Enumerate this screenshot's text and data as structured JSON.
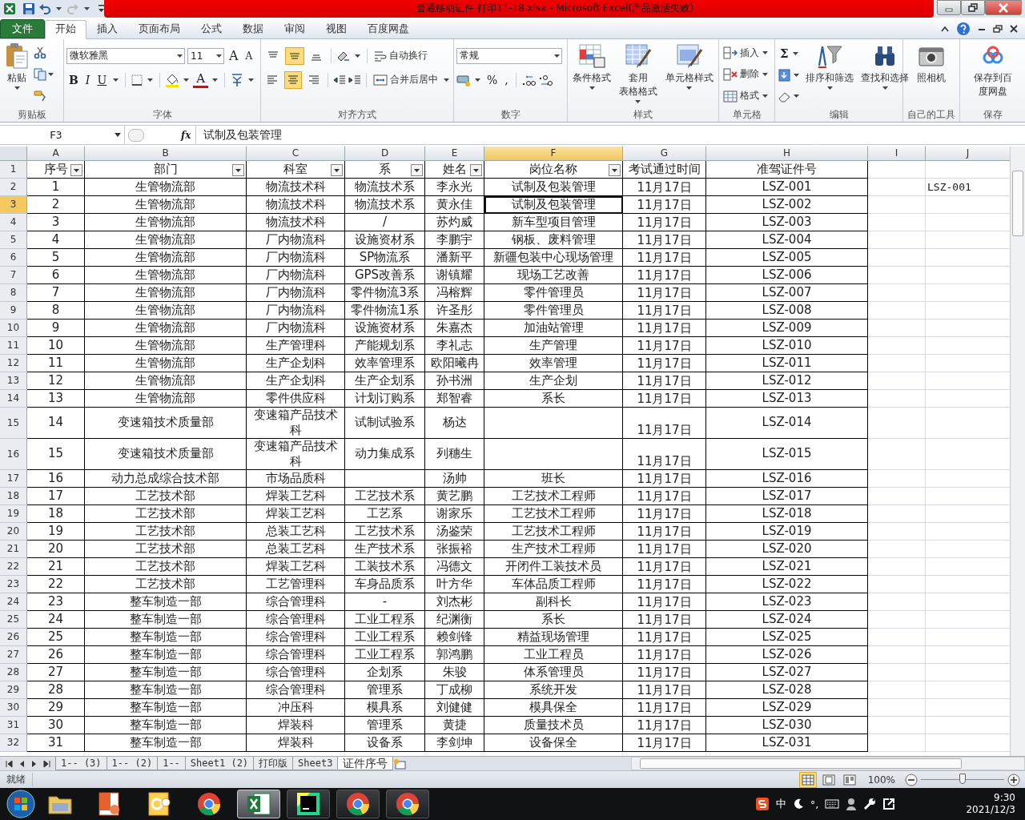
{
  "window": {
    "title": "普通移动证件 打印11-18.xlsx  -  Microsoft Excel(产品激活失败)"
  },
  "tabs": [
    {
      "label": "文件",
      "kind": "file",
      "selected": false
    },
    {
      "label": "开始",
      "kind": "tab",
      "selected": true
    },
    {
      "label": "插入",
      "kind": "tab",
      "selected": false
    },
    {
      "label": "页面布局",
      "kind": "tab",
      "selected": false
    },
    {
      "label": "公式",
      "kind": "tab",
      "selected": false
    },
    {
      "label": "数据",
      "kind": "tab",
      "selected": false
    },
    {
      "label": "审阅",
      "kind": "tab",
      "selected": false
    },
    {
      "label": "视图",
      "kind": "tab",
      "selected": false
    },
    {
      "label": "百度网盘",
      "kind": "tab",
      "selected": false
    }
  ],
  "ribbon": [
    {
      "kind": "clipboard",
      "label": "剪贴板",
      "paste": "粘贴"
    },
    {
      "kind": "font",
      "label": "字体",
      "font": "微软雅黑",
      "size": "11",
      "grow": "A",
      "shrink": "A",
      "bold": "B",
      "italic": "I",
      "underline": "U",
      "font_color_label": "A"
    },
    {
      "kind": "alignment",
      "label": "对齐方式",
      "wrap": "自动换行",
      "merge": "合并后居中",
      "vertical": [
        {
          "kind": "top",
          "selected": false
        },
        {
          "kind": "middle",
          "selected": true
        },
        {
          "kind": "bottom",
          "selected": false
        }
      ],
      "horizontal": [
        {
          "kind": "left",
          "selected": false
        },
        {
          "kind": "center",
          "selected": true
        },
        {
          "kind": "right",
          "selected": false
        }
      ]
    },
    {
      "kind": "number",
      "label": "数字",
      "format": "常规",
      "percent": "%",
      "comma": ","
    },
    {
      "kind": "big",
      "label": "样式",
      "buttons": [
        {
          "kind": "conditional",
          "lines": [
            "条件格式"
          ],
          "dropdown": true
        },
        {
          "kind": "table",
          "lines": [
            "套用",
            "表格格式"
          ],
          "dropdown": true
        },
        {
          "kind": "cellstyle",
          "lines": [
            "单元格样式"
          ],
          "dropdown": true
        }
      ]
    },
    {
      "kind": "cells",
      "label": "单元格",
      "buttons": [
        {
          "kind": "insert",
          "label": "插入"
        },
        {
          "kind": "delete",
          "label": "删除"
        },
        {
          "kind": "format",
          "label": "格式"
        }
      ]
    },
    {
      "kind": "editing",
      "label": "编辑",
      "sum": "Σ",
      "buttons": [
        {
          "kind": "sort",
          "lines": [
            "排序和筛选"
          ],
          "dropdown": true
        },
        {
          "kind": "find",
          "lines": [
            "查找和选择"
          ],
          "dropdown": true
        }
      ]
    },
    {
      "kind": "big",
      "label": "自己的工具",
      "buttons": [
        {
          "kind": "camera",
          "lines": [
            "照相机"
          ],
          "dropdown": false
        }
      ]
    },
    {
      "kind": "big",
      "label": "保存",
      "buttons": [
        {
          "kind": "cloud",
          "lines": [
            "保存到百",
            "度网盘"
          ],
          "dropdown": false
        }
      ]
    }
  ],
  "formula_bar": {
    "name_box": "F3",
    "fx": "fx",
    "content": "试制及包装管理"
  },
  "columns": [
    {
      "letter": "A",
      "selected": false
    },
    {
      "letter": "B",
      "selected": false
    },
    {
      "letter": "C",
      "selected": false
    },
    {
      "letter": "D",
      "selected": false
    },
    {
      "letter": "E",
      "selected": false
    },
    {
      "letter": "F",
      "selected": true
    },
    {
      "letter": "G",
      "selected": false
    },
    {
      "letter": "H",
      "selected": false
    },
    {
      "letter": "I",
      "selected": false
    },
    {
      "letter": "J",
      "selected": false
    }
  ],
  "header_row": {
    "number": "1",
    "selected": false,
    "cells": [
      {
        "text": "序号",
        "filter": true
      },
      {
        "text": "部门",
        "filter": true
      },
      {
        "text": "科室",
        "filter": true
      },
      {
        "text": "系",
        "filter": true
      },
      {
        "text": "姓名",
        "filter": true
      },
      {
        "text": "岗位名称",
        "filter": true
      },
      {
        "text": "考试通过时间",
        "filter": false
      },
      {
        "text": "准驾证件号",
        "filter": false
      }
    ]
  },
  "rows": [
    {
      "number": "2",
      "selected": false,
      "cells": {
        "A": "1",
        "B": "生管物流部",
        "C": "物流技术科",
        "D": "物流技术系",
        "E": "李永光",
        "F": "试制及包装管理",
        "G": "11月17日",
        "H": "LSZ-001",
        "J": "LSZ-001"
      }
    },
    {
      "number": "3",
      "selected": true,
      "cells": {
        "A": "2",
        "B": "生管物流部",
        "C": "物流技术科",
        "D": "物流技术系",
        "E": "黄永佳",
        "F": "试制及包装管理",
        "G": "11月17日",
        "H": "LSZ-002"
      }
    },
    {
      "number": "4",
      "selected": false,
      "cells": {
        "A": "3",
        "B": "生管物流部",
        "C": "物流技术科",
        "D": "/",
        "E": "苏灼威",
        "F": "新车型项目管理",
        "G": "11月17日",
        "H": "LSZ-003"
      }
    },
    {
      "number": "5",
      "selected": false,
      "cells": {
        "A": "4",
        "B": "生管物流部",
        "C": "厂内物流科",
        "D": "设施资材系",
        "E": "李鹏宇",
        "F": "钢板、废料管理",
        "G": "11月17日",
        "H": "LSZ-004"
      }
    },
    {
      "number": "6",
      "selected": false,
      "cells": {
        "A": "5",
        "B": "生管物流部",
        "C": "厂内物流科",
        "D": "SP物流系",
        "E": "潘新平",
        "F": "新疆包装中心现场管理",
        "G": "11月17日",
        "H": "LSZ-005"
      }
    },
    {
      "number": "7",
      "selected": false,
      "cells": {
        "A": "6",
        "B": "生管物流部",
        "C": "厂内物流科",
        "D": "GPS改善系",
        "E": "谢镇耀",
        "F": "现场工艺改善",
        "G": "11月17日",
        "H": "LSZ-006"
      }
    },
    {
      "number": "8",
      "selected": false,
      "cells": {
        "A": "7",
        "B": "生管物流部",
        "C": "厂内物流科",
        "D": "零件物流3系",
        "E": "冯榕辉",
        "F": "零件管理员",
        "G": "11月17日",
        "H": "LSZ-007"
      }
    },
    {
      "number": "9",
      "selected": false,
      "cells": {
        "A": "8",
        "B": "生管物流部",
        "C": "厂内物流科",
        "D": "零件物流1系",
        "E": "许圣彤",
        "F": "零件管理员",
        "G": "11月17日",
        "H": "LSZ-008"
      }
    },
    {
      "number": "10",
      "selected": false,
      "cells": {
        "A": "9",
        "B": "生管物流部",
        "C": "厂内物流科",
        "D": "设施资材系",
        "E": "朱嘉杰",
        "F": "加油站管理",
        "G": "11月17日",
        "H": "LSZ-009"
      }
    },
    {
      "number": "11",
      "selected": false,
      "cells": {
        "A": "10",
        "B": "生管物流部",
        "C": "生产管理科",
        "D": "产能规划系",
        "E": "李礼志",
        "F": "生产管理",
        "G": "11月17日",
        "H": "LSZ-010"
      }
    },
    {
      "number": "12",
      "selected": false,
      "cells": {
        "A": "11",
        "B": "生管物流部",
        "C": "生产企划科",
        "D": "效率管理系",
        "E": "欧阳曦冉",
        "F": "效率管理",
        "G": "11月17日",
        "H": "LSZ-011"
      }
    },
    {
      "number": "13",
      "selected": false,
      "cells": {
        "A": "12",
        "B": "生管物流部",
        "C": "生产企划科",
        "D": "生产企划系",
        "E": "孙书洲",
        "F": "生产企划",
        "G": "11月17日",
        "H": "LSZ-012"
      }
    },
    {
      "number": "14",
      "selected": false,
      "cells": {
        "A": "13",
        "B": "生管物流部",
        "C": "零件供应科",
        "D": "计划订购系",
        "E": "郑智睿",
        "F": "系长",
        "G": "11月17日",
        "H": "LSZ-013"
      }
    },
    {
      "number": "15",
      "selected": false,
      "cells": {
        "A": "14",
        "B": "变速箱技术质量部",
        "C": "变速箱产品技术科",
        "D": "试制试验系",
        "E": "杨达",
        "G": "11月17日",
        "H": "LSZ-014"
      }
    },
    {
      "number": "16",
      "selected": false,
      "cells": {
        "A": "15",
        "B": "变速箱技术质量部",
        "C": "变速箱产品技术科",
        "D": "动力集成系",
        "E": "列穗生",
        "G": "11月17日",
        "H": "LSZ-015"
      }
    },
    {
      "number": "17",
      "selected": false,
      "cells": {
        "A": "16",
        "B": "动力总成综合技术部",
        "C": "市场品质科",
        "E": "汤帅",
        "F": "班长",
        "G": "11月17日",
        "H": "LSZ-016"
      }
    },
    {
      "number": "18",
      "selected": false,
      "cells": {
        "A": "17",
        "B": "工艺技术部",
        "C": "焊装工艺科",
        "D": "工艺技术系",
        "E": "黄艺鹏",
        "F": "工艺技术工程师",
        "G": "11月17日",
        "H": "LSZ-017"
      }
    },
    {
      "number": "19",
      "selected": false,
      "cells": {
        "A": "18",
        "B": "工艺技术部",
        "C": "焊装工艺科",
        "D": "工艺系",
        "E": "谢家乐",
        "F": "工艺技术工程师",
        "G": "11月17日",
        "H": "LSZ-018"
      }
    },
    {
      "number": "20",
      "selected": false,
      "cells": {
        "A": "19",
        "B": "工艺技术部",
        "C": "总装工艺科",
        "D": "工艺技术系",
        "E": "汤鉴荣",
        "F": "工艺技术工程师",
        "G": "11月17日",
        "H": "LSZ-019"
      }
    },
    {
      "number": "21",
      "selected": false,
      "cells": {
        "A": "20",
        "B": "工艺技术部",
        "C": "总装工艺科",
        "D": "生产技术系",
        "E": "张振裕",
        "F": "生产技术工程师",
        "G": "11月17日",
        "H": "LSZ-020"
      }
    },
    {
      "number": "22",
      "selected": false,
      "cells": {
        "A": "21",
        "B": "工艺技术部",
        "C": "焊装工艺科",
        "D": "工装技术系",
        "E": "冯德文",
        "F": "开闭件工装技术员",
        "G": "11月17日",
        "H": "LSZ-021"
      }
    },
    {
      "number": "23",
      "selected": false,
      "cells": {
        "A": "22",
        "B": "工艺技术部",
        "C": "工艺管理科",
        "D": "车身品质系",
        "E": "叶方华",
        "F": "车体品质工程师",
        "G": "11月17日",
        "H": "LSZ-022"
      }
    },
    {
      "number": "24",
      "selected": false,
      "cells": {
        "A": "23",
        "B": "整车制造一部",
        "C": "综合管理科",
        "D": "-",
        "E": "刘杰彬",
        "F": "副科长",
        "G": "11月17日",
        "H": "LSZ-023"
      }
    },
    {
      "number": "25",
      "selected": false,
      "cells": {
        "A": "24",
        "B": "整车制造一部",
        "C": "综合管理科",
        "D": "工业工程系",
        "E": "纪渊衡",
        "F": "系长",
        "G": "11月17日",
        "H": "LSZ-024"
      }
    },
    {
      "number": "26",
      "selected": false,
      "cells": {
        "A": "25",
        "B": "整车制造一部",
        "C": "综合管理科",
        "D": "工业工程系",
        "E": "赖剑锋",
        "F": "精益现场管理",
        "G": "11月17日",
        "H": "LSZ-025"
      }
    },
    {
      "number": "27",
      "selected": false,
      "cells": {
        "A": "26",
        "B": "整车制造一部",
        "C": "综合管理科",
        "D": "工业工程系",
        "E": "郭鸿鹏",
        "F": "工业工程员",
        "G": "11月17日",
        "H": "LSZ-026"
      }
    },
    {
      "number": "28",
      "selected": false,
      "cells": {
        "A": "27",
        "B": "整车制造一部",
        "C": "综合管理科",
        "D": "企划系",
        "E": "朱骏",
        "F": "体系管理员",
        "G": "11月17日",
        "H": "LSZ-027"
      }
    },
    {
      "number": "29",
      "selected": false,
      "cells": {
        "A": "28",
        "B": "整车制造一部",
        "C": "综合管理科",
        "D": "管理系",
        "E": "丁成柳",
        "F": "系统开发",
        "G": "11月17日",
        "H": "LSZ-028"
      }
    },
    {
      "number": "30",
      "selected": false,
      "cells": {
        "A": "29",
        "B": "整车制造一部",
        "C": "冲压科",
        "D": "模具系",
        "E": "刘健健",
        "F": "模具保全",
        "G": "11月17日",
        "H": "LSZ-029"
      }
    },
    {
      "number": "31",
      "selected": false,
      "cells": {
        "A": "30",
        "B": "整车制造一部",
        "C": "焊装科",
        "D": "管理系",
        "E": "黄捷",
        "F": "质量技术员",
        "G": "11月17日",
        "H": "LSZ-030"
      }
    },
    {
      "number": "32",
      "selected": false,
      "cells": {
        "A": "31",
        "B": "整车制造一部",
        "C": "焊装科",
        "D": "设备系",
        "E": "李剑坤",
        "F": "设备保全",
        "G": "11月17日",
        "H": "LSZ-031"
      }
    }
  ],
  "sheet_tabs": [
    {
      "label": "1-- (3)",
      "selected": false
    },
    {
      "label": "1-- (2)",
      "selected": false
    },
    {
      "label": "1--",
      "selected": false
    },
    {
      "label": "Sheet1 (2)",
      "selected": false
    },
    {
      "label": "打印版",
      "selected": false
    },
    {
      "label": "Sheet3",
      "selected": false
    },
    {
      "label": "证件序号",
      "selected": true
    }
  ],
  "status_bar": {
    "status": "就绪",
    "views": [
      {
        "kind": "normal",
        "selected": true
      },
      {
        "kind": "layout",
        "selected": false
      },
      {
        "kind": "pagebreak",
        "selected": false
      }
    ],
    "zoom": "100%",
    "level": 0.5
  },
  "taskbar": {
    "apps": [
      {
        "kind": "folder",
        "running": false,
        "selected": false
      },
      {
        "kind": "powerpoint",
        "running": false,
        "selected": false
      },
      {
        "kind": "outlook",
        "running": false,
        "selected": false
      },
      {
        "kind": "chrome",
        "running": false,
        "selected": false
      },
      {
        "kind": "excel",
        "running": true,
        "selected": true
      },
      {
        "kind": "pycharm",
        "running": true,
        "selected": false
      },
      {
        "kind": "chrome",
        "running": true,
        "selected": false
      },
      {
        "kind": "chrome",
        "running": true,
        "selected": false
      }
    ],
    "ime": "中",
    "punct": "°,",
    "time": "9:30",
    "date": "2021/12/3"
  }
}
